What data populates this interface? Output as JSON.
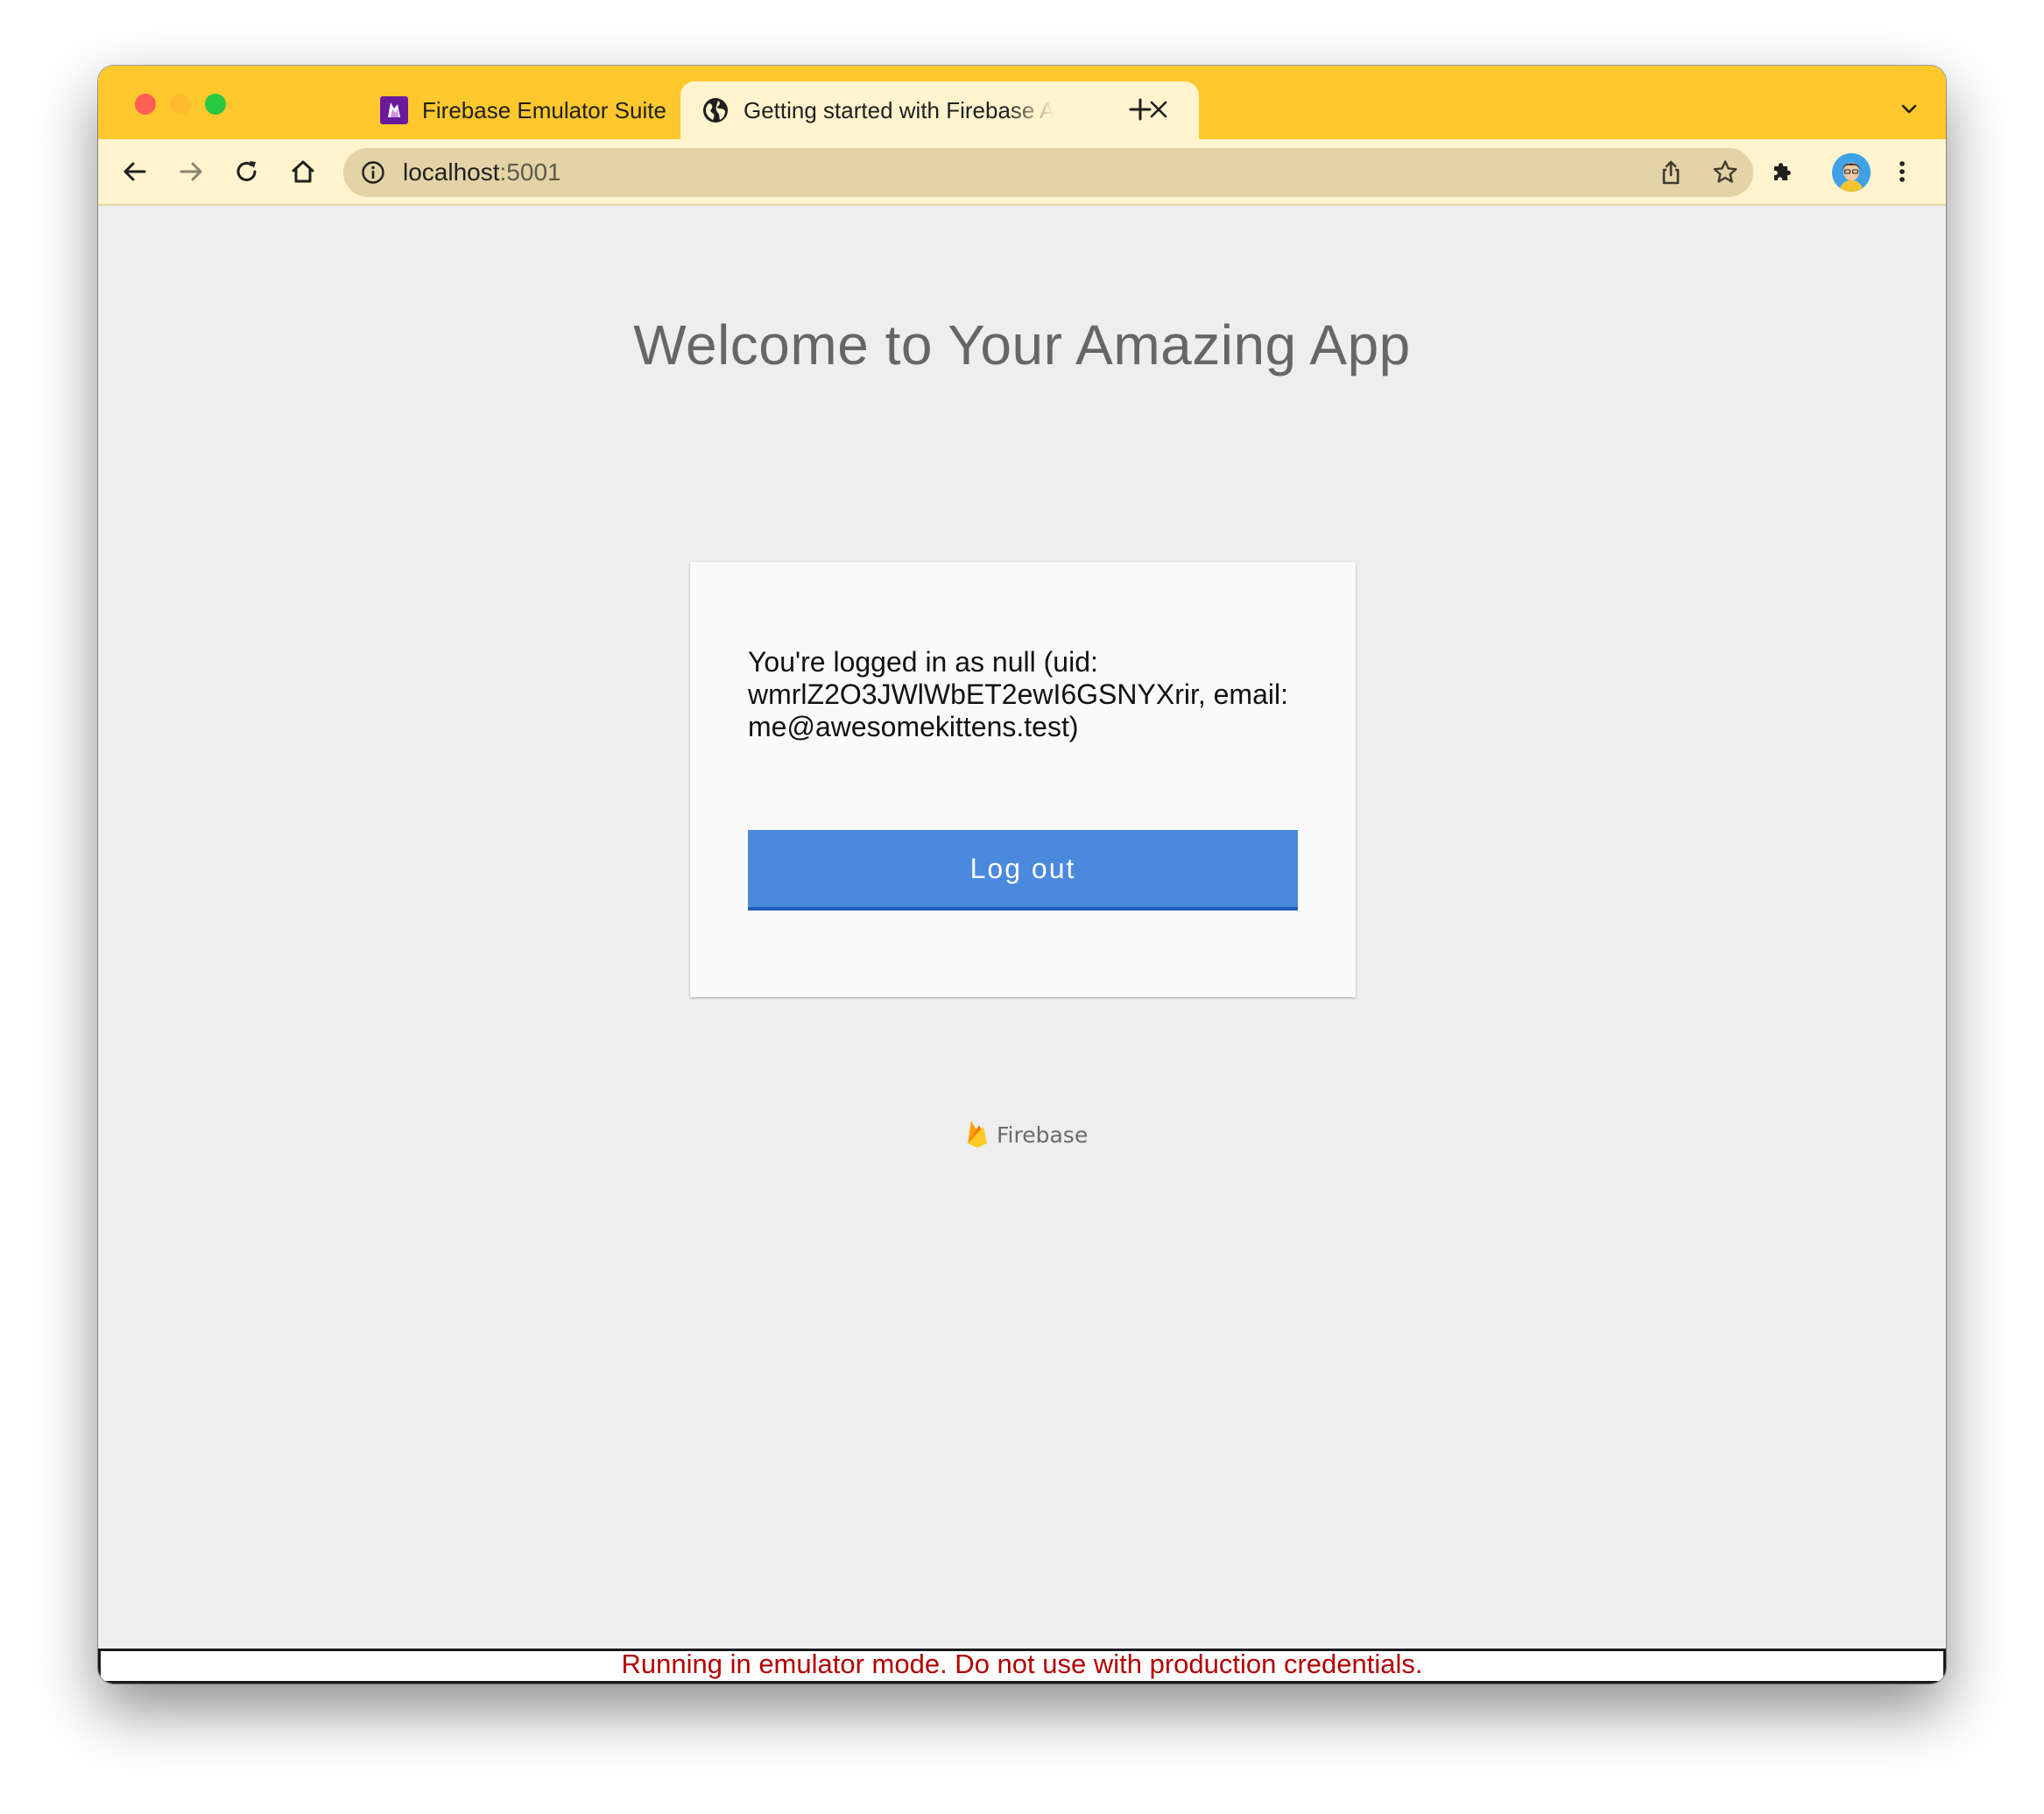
{
  "tabs": [
    {
      "title": "Firebase Emulator Suite",
      "favicon": "firebase-emulator-icon",
      "active": false
    },
    {
      "title": "Getting started with Firebase Authentication",
      "favicon": "globe-icon",
      "active": true
    }
  ],
  "toolbar": {
    "url_host": "localhost",
    "url_port": ":5001"
  },
  "page": {
    "title": "Welcome to Your Amazing App",
    "login_message": "You're logged in as null (uid: wmrlZ2O3JWlWbET2ewI6GSNYXrir, email: me@awesomekittens.test)",
    "logout_label": "Log out",
    "footer_logo_text": "Firebase"
  },
  "banner": {
    "text": "Running in emulator mode. Do not use with production credentials."
  },
  "colors": {
    "tabstrip": "#ffc82c",
    "toolbar": "#fff4ce",
    "button": "#4a89dc",
    "banner_text": "#b30000"
  }
}
